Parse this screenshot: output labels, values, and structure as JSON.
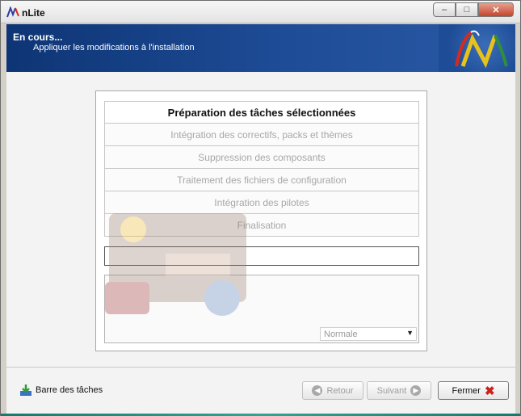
{
  "window": {
    "title": "nLite",
    "minimize_icon": "minimize-icon",
    "maximize_icon": "maximize-icon",
    "close_icon": "close-icon"
  },
  "header": {
    "title": "En cours...",
    "subtitle": "Appliquer les modifications à l'installation",
    "logo_icon": "nlite-logo",
    "accent_color": "#1e4c96"
  },
  "steps": [
    {
      "label": "Préparation des tâches sélectionnées",
      "active": true
    },
    {
      "label": "Intégration des correctifs, packs et thèmes",
      "active": false
    },
    {
      "label": "Suppression des composants",
      "active": false
    },
    {
      "label": "Traitement des fichiers de configuration",
      "active": false
    },
    {
      "label": "Intégration des pilotes",
      "active": false
    },
    {
      "label": "Finalisation",
      "active": false
    }
  ],
  "progress": {
    "value": 0
  },
  "priority": {
    "selected": "Normale"
  },
  "footer": {
    "taskbar_label": "Barre des tâches",
    "back_label": "Retour",
    "next_label": "Suivant",
    "close_label": "Fermer"
  }
}
